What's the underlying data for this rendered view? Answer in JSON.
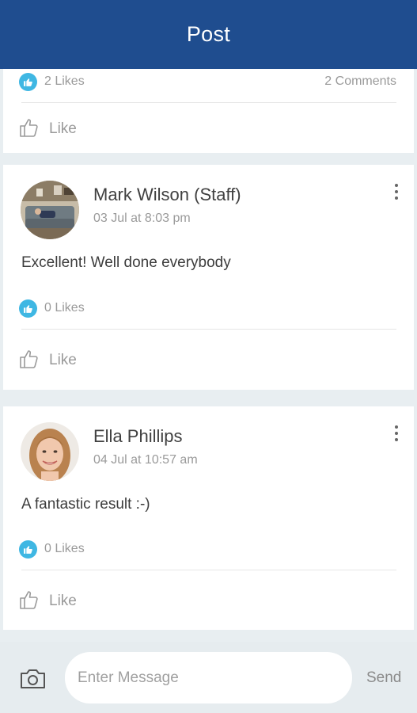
{
  "header": {
    "title": "Post"
  },
  "colors": {
    "header_bg": "#1f4d8f",
    "like_badge": "#3fb7e3",
    "page_bg": "#e8eef1"
  },
  "posts": [
    {
      "likes": "2 Likes",
      "comments": "2 Comments",
      "like_label": "Like"
    },
    {
      "author": "Mark Wilson (Staff)",
      "timestamp": "03 Jul at 8:03 pm",
      "text": "Excellent! Well done everybody",
      "likes": "0 Likes",
      "like_label": "Like",
      "avatar_icon": "photo-living-room"
    },
    {
      "author": "Ella Phillips",
      "timestamp": "04 Jul at 10:57 am",
      "text": "A fantastic result :-)",
      "likes": "0 Likes",
      "like_label": "Like",
      "avatar_icon": "photo-woman-smiling"
    }
  ],
  "composer": {
    "placeholder": "Enter Message",
    "value": "",
    "send_label": "Send",
    "camera_icon": "camera-icon"
  }
}
